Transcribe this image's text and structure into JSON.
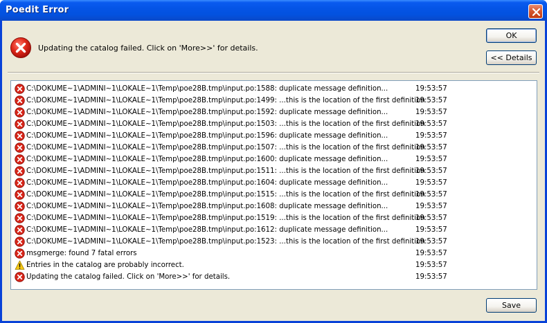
{
  "window": {
    "title": "Poedit Error"
  },
  "message": "Updating the catalog failed. Click on 'More>>' for details.",
  "buttons": {
    "ok": "OK",
    "details": "<< Details",
    "save": "Save"
  },
  "log": [
    {
      "icon": "error",
      "text": "C:\\DOKUME~1\\ADMINI~1\\LOKALE~1\\Temp\\poe28B.tmp\\input.po:1588: duplicate message definition...",
      "time": "19:53:57"
    },
    {
      "icon": "error",
      "text": "C:\\DOKUME~1\\ADMINI~1\\LOKALE~1\\Temp\\poe28B.tmp\\input.po:1499: ...this is the location of the first definition",
      "time": "19:53:57"
    },
    {
      "icon": "error",
      "text": "C:\\DOKUME~1\\ADMINI~1\\LOKALE~1\\Temp\\poe28B.tmp\\input.po:1592: duplicate message definition...",
      "time": "19:53:57"
    },
    {
      "icon": "error",
      "text": "C:\\DOKUME~1\\ADMINI~1\\LOKALE~1\\Temp\\poe28B.tmp\\input.po:1503: ...this is the location of the first definition",
      "time": "19:53:57"
    },
    {
      "icon": "error",
      "text": "C:\\DOKUME~1\\ADMINI~1\\LOKALE~1\\Temp\\poe28B.tmp\\input.po:1596: duplicate message definition...",
      "time": "19:53:57"
    },
    {
      "icon": "error",
      "text": "C:\\DOKUME~1\\ADMINI~1\\LOKALE~1\\Temp\\poe28B.tmp\\input.po:1507: ...this is the location of the first definition",
      "time": "19:53:57"
    },
    {
      "icon": "error",
      "text": "C:\\DOKUME~1\\ADMINI~1\\LOKALE~1\\Temp\\poe28B.tmp\\input.po:1600: duplicate message definition...",
      "time": "19:53:57"
    },
    {
      "icon": "error",
      "text": "C:\\DOKUME~1\\ADMINI~1\\LOKALE~1\\Temp\\poe28B.tmp\\input.po:1511: ...this is the location of the first definition",
      "time": "19:53:57"
    },
    {
      "icon": "error",
      "text": "C:\\DOKUME~1\\ADMINI~1\\LOKALE~1\\Temp\\poe28B.tmp\\input.po:1604: duplicate message definition...",
      "time": "19:53:57"
    },
    {
      "icon": "error",
      "text": "C:\\DOKUME~1\\ADMINI~1\\LOKALE~1\\Temp\\poe28B.tmp\\input.po:1515: ...this is the location of the first definition",
      "time": "19:53:57"
    },
    {
      "icon": "error",
      "text": "C:\\DOKUME~1\\ADMINI~1\\LOKALE~1\\Temp\\poe28B.tmp\\input.po:1608: duplicate message definition...",
      "time": "19:53:57"
    },
    {
      "icon": "error",
      "text": "C:\\DOKUME~1\\ADMINI~1\\LOKALE~1\\Temp\\poe28B.tmp\\input.po:1519: ...this is the location of the first definition",
      "time": "19:53:57"
    },
    {
      "icon": "error",
      "text": "C:\\DOKUME~1\\ADMINI~1\\LOKALE~1\\Temp\\poe28B.tmp\\input.po:1612: duplicate message definition...",
      "time": "19:53:57"
    },
    {
      "icon": "error",
      "text": "C:\\DOKUME~1\\ADMINI~1\\LOKALE~1\\Temp\\poe28B.tmp\\input.po:1523: ...this is the location of the first definition",
      "time": "19:53:57"
    },
    {
      "icon": "error",
      "text": "msgmerge: found 7 fatal errors",
      "time": "19:53:57"
    },
    {
      "icon": "warning",
      "text": "Entries in the catalog are probably incorrect.",
      "time": "19:53:57"
    },
    {
      "icon": "error",
      "text": "Updating the catalog failed. Click on 'More>>' for details.",
      "time": "19:53:57"
    }
  ]
}
